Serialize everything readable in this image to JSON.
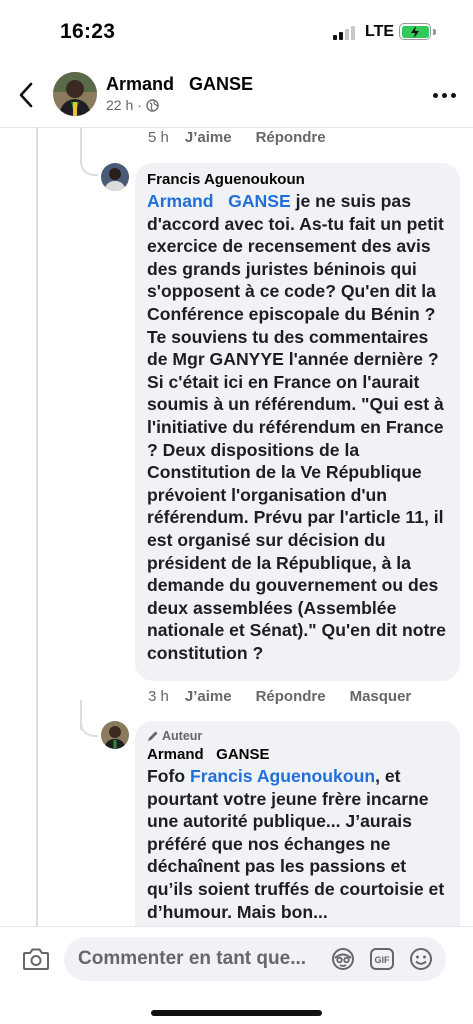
{
  "status_bar": {
    "time": "16:23",
    "network": "LTE"
  },
  "header": {
    "name": "Armand   GANSE",
    "time_ago": "22 h",
    "separator": "·"
  },
  "top_actions": {
    "time": "5 h",
    "like": "J’aime",
    "reply": "Répondre"
  },
  "comment1": {
    "author": "Francis Aguenoukoun",
    "mention": "Armand   GANSE",
    "text": " je ne suis pas d'accord avec toi. As-tu fait un petit exercice de recensement des avis des grands juristes béninois qui s'opposent à ce code? Qu'en dit la Conférence episcopale du Bénin ?Te souviens tu des commentaires de Mgr GANYYE l'année dernière ? Si c'était ici en France on l'aurait soumis à un référendum. \"Qui est à l'initiative du référendum en France ? Deux dispositions de la Constitution de la Ve République prévoient l'organisation d'un référendum. Prévu par l'article 11, il est organisé sur décision du président de la République, à la demande du gouvernement ou des deux assemblées (Assemblée nationale et Sénat).\" Qu'en dit notre constitution ?",
    "actions": {
      "time": "3 h",
      "like": "J’aime",
      "reply": "Répondre",
      "hide": "Masquer"
    }
  },
  "comment2": {
    "badge": "Auteur",
    "author": "Armand   GANSE",
    "prefix": "Fofo ",
    "mention": "Francis Aguenoukoun",
    "text": ", et pourtant votre jeune frère incarne une autorité publique... J’aurais préféré que nos échanges ne déchaînent pas les passions et qu’ils soient truffés de courtoisie et d’humour. Mais bon..."
  },
  "composer": {
    "placeholder": "Commenter en tant que...",
    "icons": [
      "camera-icon",
      "avatar-sticker-icon",
      "gif-icon",
      "emoji-icon"
    ],
    "gif_label": "GIF"
  },
  "colors": {
    "accent": "#216fdb",
    "bubble": "#f0f2f5",
    "muted": "#65676b",
    "battery": "#34c759"
  }
}
